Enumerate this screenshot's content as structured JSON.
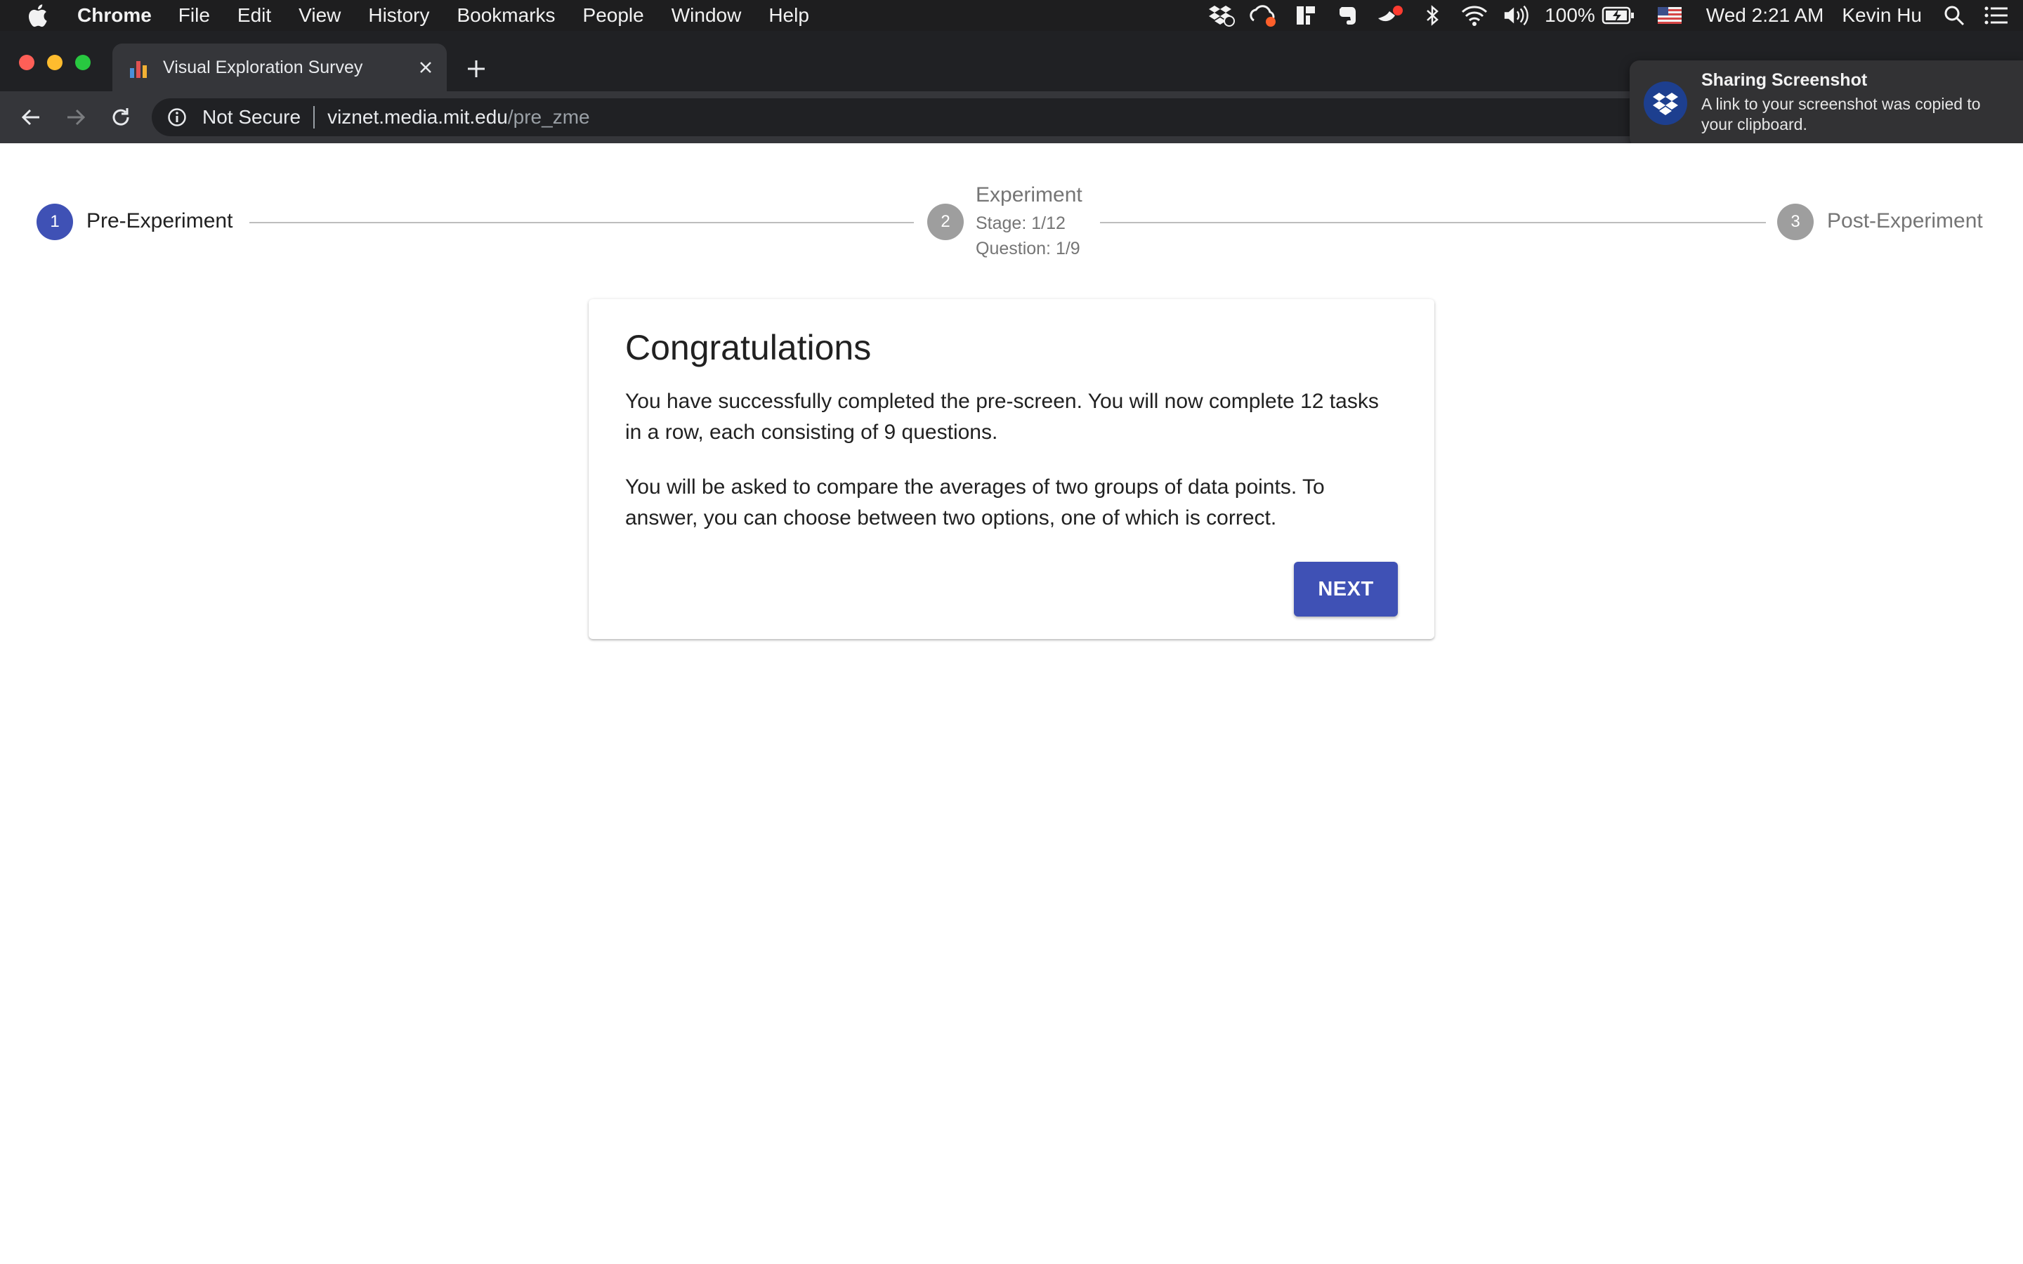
{
  "menubar": {
    "app_name": "Chrome",
    "menus": [
      "File",
      "Edit",
      "View",
      "History",
      "Bookmarks",
      "People",
      "Window",
      "Help"
    ],
    "battery": "100%",
    "datetime": "Wed 2:21 AM",
    "user": "Kevin Hu"
  },
  "browser": {
    "tab_title": "Visual Exploration Survey",
    "security_label": "Not Secure",
    "url_host": "viznet.media.mit.edu",
    "url_path": "/pre_zme"
  },
  "notification": {
    "title": "Sharing Screenshot",
    "body": "A link to your screenshot was copied to your clipboard."
  },
  "stepper": {
    "steps": [
      {
        "number": "1",
        "label": "Pre-Experiment",
        "active": true
      },
      {
        "number": "2",
        "label": "Experiment",
        "stage": "Stage: 1/12",
        "question": "Question: 1/9",
        "active": false
      },
      {
        "number": "3",
        "label": "Post-Experiment",
        "active": false
      }
    ]
  },
  "card": {
    "title": "Congratulations",
    "paragraph1": "You have successfully completed the pre-screen. You will now complete 12 tasks in a row, each consisting of 9 questions.",
    "paragraph2": "You will be asked to compare the averages of two groups of data points. To answer, you can choose between two options, one of which is correct.",
    "next_label": "NEXT"
  },
  "colors": {
    "accent": "#3f51b5",
    "inactive_step": "#9e9e9e"
  }
}
